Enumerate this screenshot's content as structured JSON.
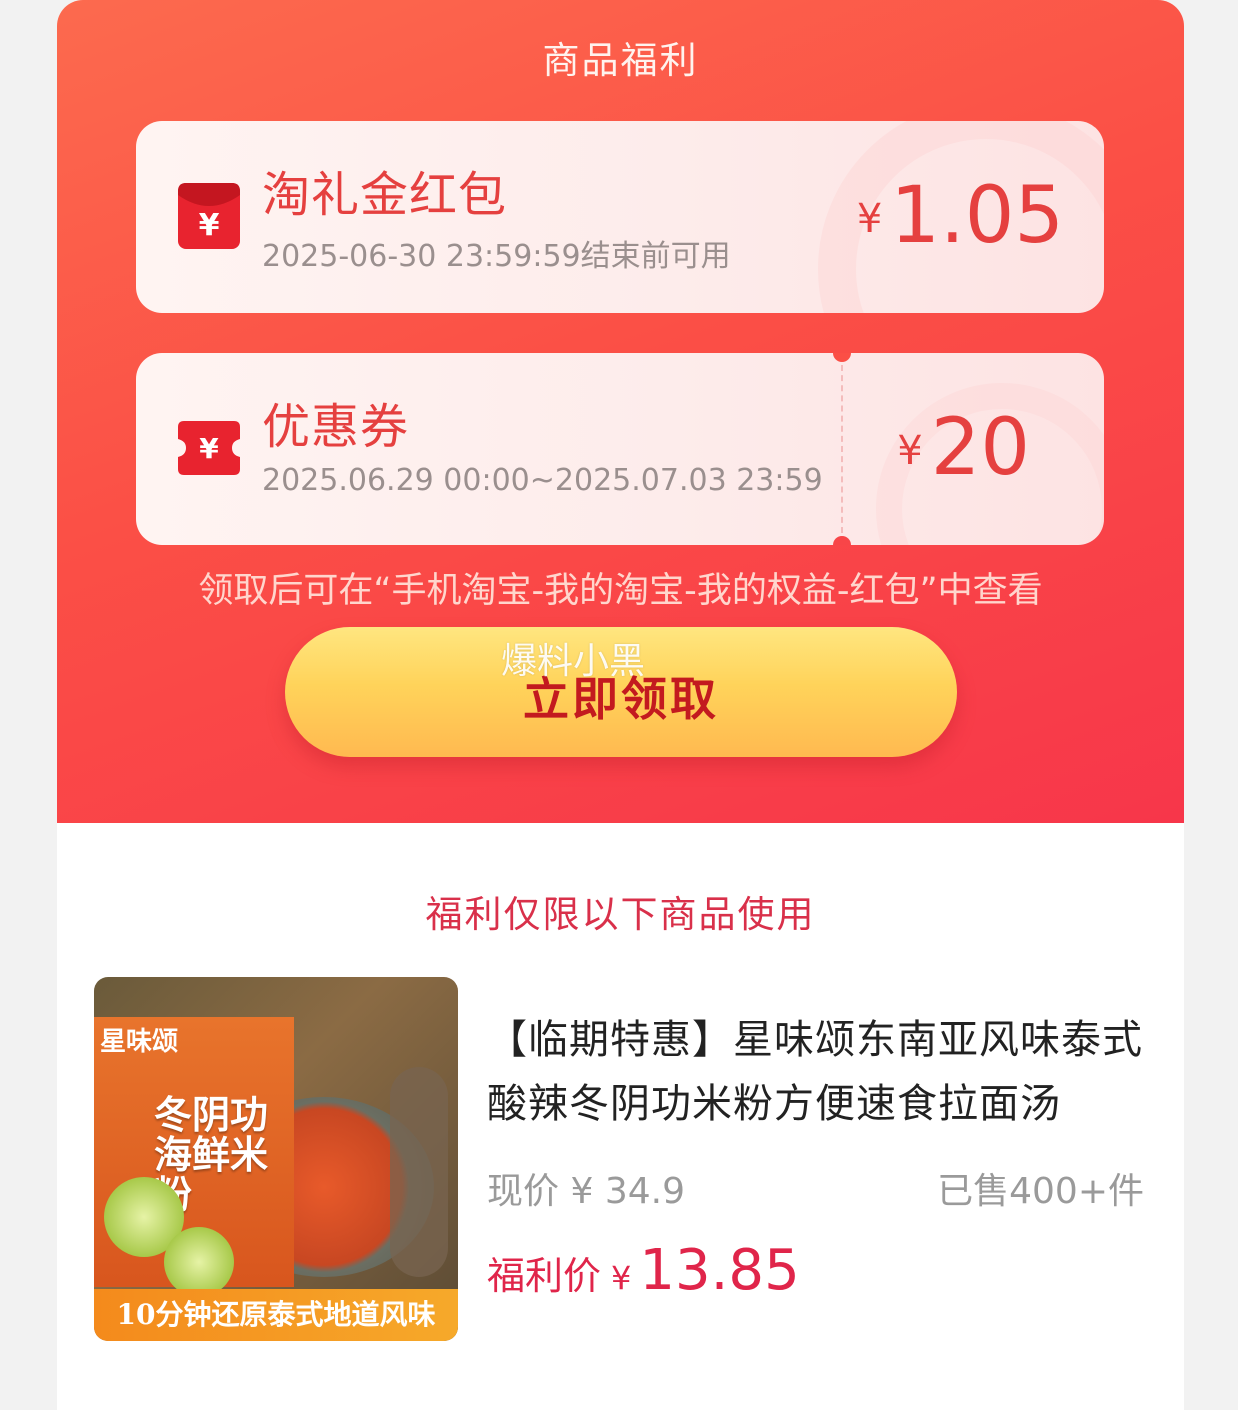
{
  "header": {
    "title": "商品福利"
  },
  "coupons": [
    {
      "title": "淘礼金红包",
      "date": "2025-06-30 23:59:59结束前可用",
      "currency": "¥",
      "amount": "1.05",
      "icon": "red-envelope-icon"
    },
    {
      "title": "优惠券",
      "date": "2025.06.29 00:00~2025.07.03 23:59",
      "currency": "¥",
      "amount": "20",
      "icon": "ticket-icon"
    }
  ],
  "tip": "领取后可在“手机淘宝-我的淘宝-我的权益-红包”中查看",
  "claim_button": {
    "label": "立即领取"
  },
  "watermark": "爆料小黑",
  "section": {
    "title": "福利仅限以下商品使用"
  },
  "product": {
    "title": "【临期特惠】星味颂东南亚风味泰式酸辣冬阴功米粉方便速食拉面汤",
    "current_price_label": "现价",
    "current_price": "¥ 34.9",
    "sold": "已售400+件",
    "welfare_label": "福利价",
    "welfare_currency": "¥",
    "welfare_price": "13.85",
    "image": {
      "brand": "星味颂",
      "name": "冬阴功海鲜米粉",
      "banner": "10分钟还原泰式地道风味"
    }
  },
  "colors": {
    "accent_red": "#e5403f",
    "button_yellow": "#ffd35a",
    "welfare_red": "#e0254a"
  }
}
